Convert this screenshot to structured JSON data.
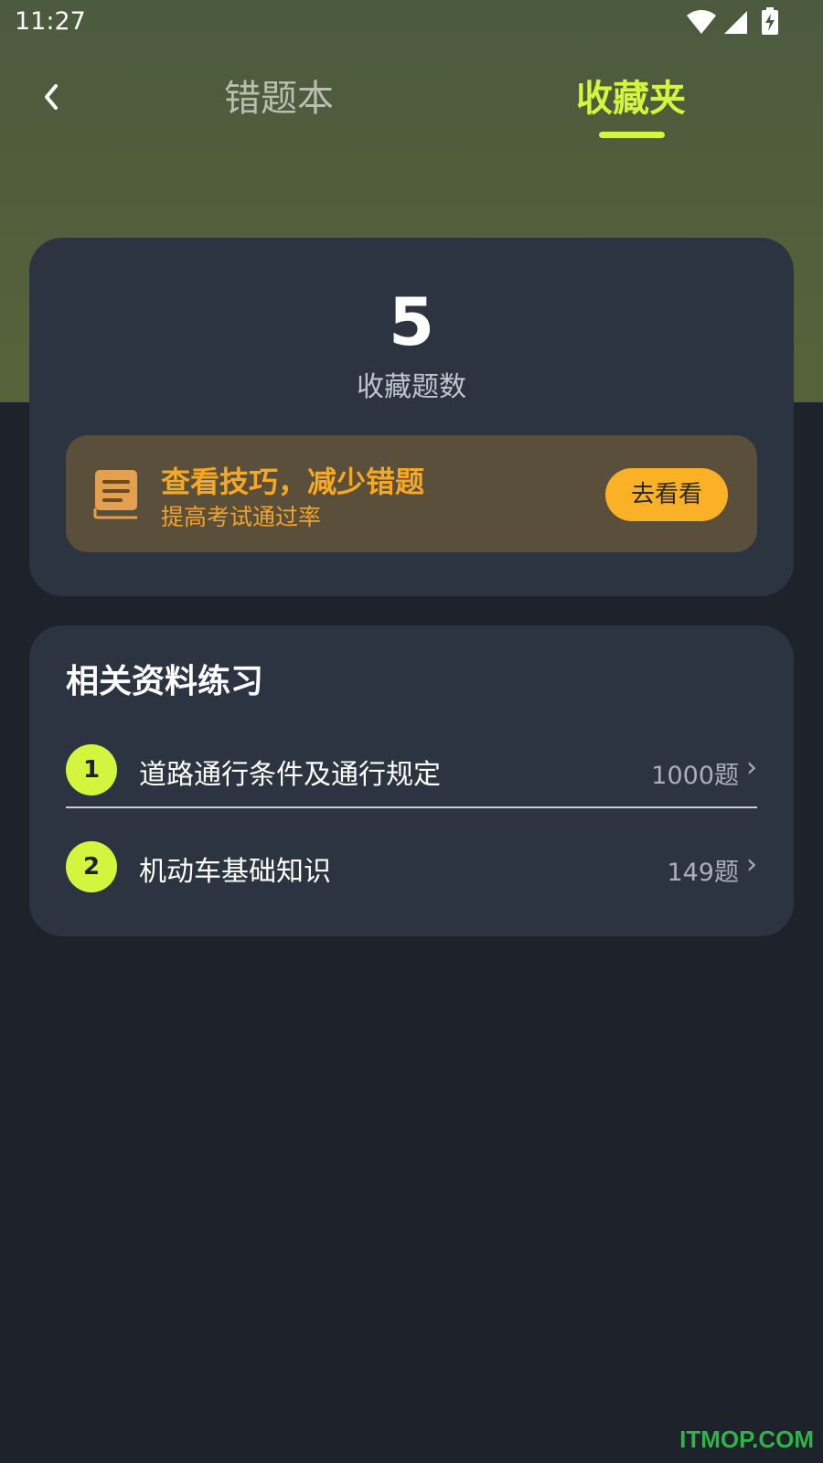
{
  "status_bar": {
    "time": "11:27",
    "icons": [
      "wifi-icon",
      "cellular-signal-icon",
      "battery-charging-icon"
    ]
  },
  "header": {
    "back_icon": "chevron-left-icon",
    "tabs": [
      {
        "label": "错题本",
        "active": false
      },
      {
        "label": "收藏夹",
        "active": true
      }
    ]
  },
  "summary": {
    "count": "5",
    "count_label": "收藏题数",
    "tips": {
      "icon": "book-icon",
      "title": "查看技巧，减少错题",
      "subtitle": "提高考试通过率",
      "button_label": "去看看"
    }
  },
  "related": {
    "title": "相关资料练习",
    "items": [
      {
        "index": "1",
        "label": "道路通行条件及通行规定",
        "count": "1000题"
      },
      {
        "index": "2",
        "label": "机动车基础知识",
        "count": "149题"
      }
    ],
    "chevron_icon": "chevron-right-icon"
  },
  "watermark": "ITMOP.COM",
  "colors": {
    "accent": "#d4f53d",
    "orange": "#f7a823",
    "button": "#fbb126",
    "card": "#2c3441",
    "background": "#1d222b",
    "header": "#4c5a3e"
  }
}
